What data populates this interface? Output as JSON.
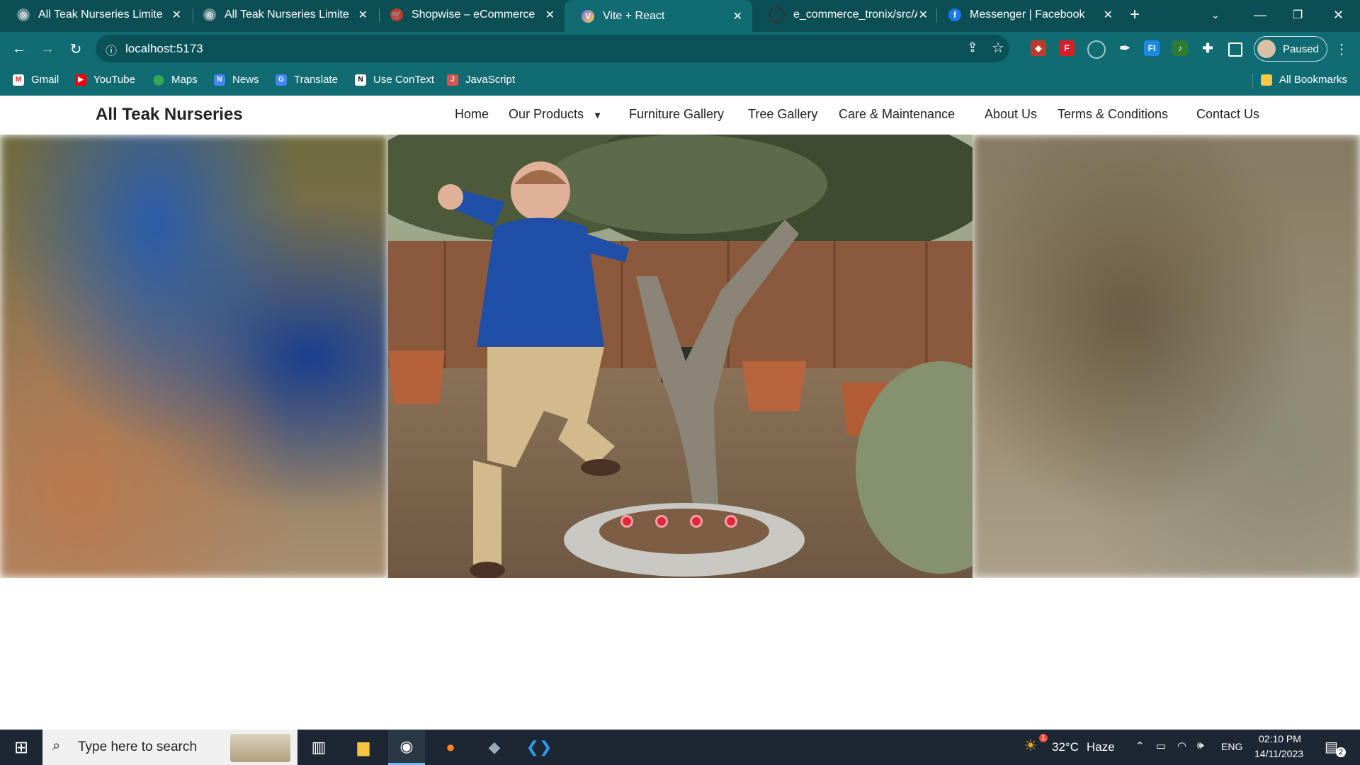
{
  "browser": {
    "tabs": [
      {
        "title": "All Teak Nurseries Limited |",
        "active": false
      },
      {
        "title": "All Teak Nurseries Limited |",
        "active": false
      },
      {
        "title": "Shopwise – eCommerce Th",
        "active": false
      },
      {
        "title": "Vite + React",
        "active": true
      },
      {
        "title": "e_commerce_tronix/src/Ap",
        "active": false
      },
      {
        "title": "Messenger | Facebook",
        "active": false
      }
    ],
    "new_tab": "+",
    "url": "localhost:5173",
    "profile_label": "Paused",
    "bookmarks": [
      {
        "label": "Gmail",
        "icon": "gmail-icon"
      },
      {
        "label": "YouTube",
        "icon": "youtube-icon"
      },
      {
        "label": "Maps",
        "icon": "maps-icon"
      },
      {
        "label": "News",
        "icon": "news-icon"
      },
      {
        "label": "Translate",
        "icon": "translate-icon"
      },
      {
        "label": "Use ConText",
        "icon": "notion-icon"
      },
      {
        "label": "JavaScript",
        "icon": "javascript-icon"
      }
    ],
    "all_bookmarks": "All Bookmarks"
  },
  "site": {
    "brand": "All Teak Nurseries",
    "nav": [
      "Home",
      "Our Products",
      "Furniture Gallery",
      "Tree Gallery",
      "Care & Maintenance",
      "About Us",
      "Terms & Conditions",
      "Contact Us"
    ],
    "carousel": {
      "slides": 4,
      "active_slide": 3
    }
  },
  "taskbar": {
    "search_placeholder": "Type here to search",
    "weather_temp": "32°C",
    "weather_text": "Haze",
    "lang": "ENG",
    "time": "02:10 PM",
    "date": "14/11/2023",
    "notifications": "2",
    "weather_badge": "1"
  }
}
